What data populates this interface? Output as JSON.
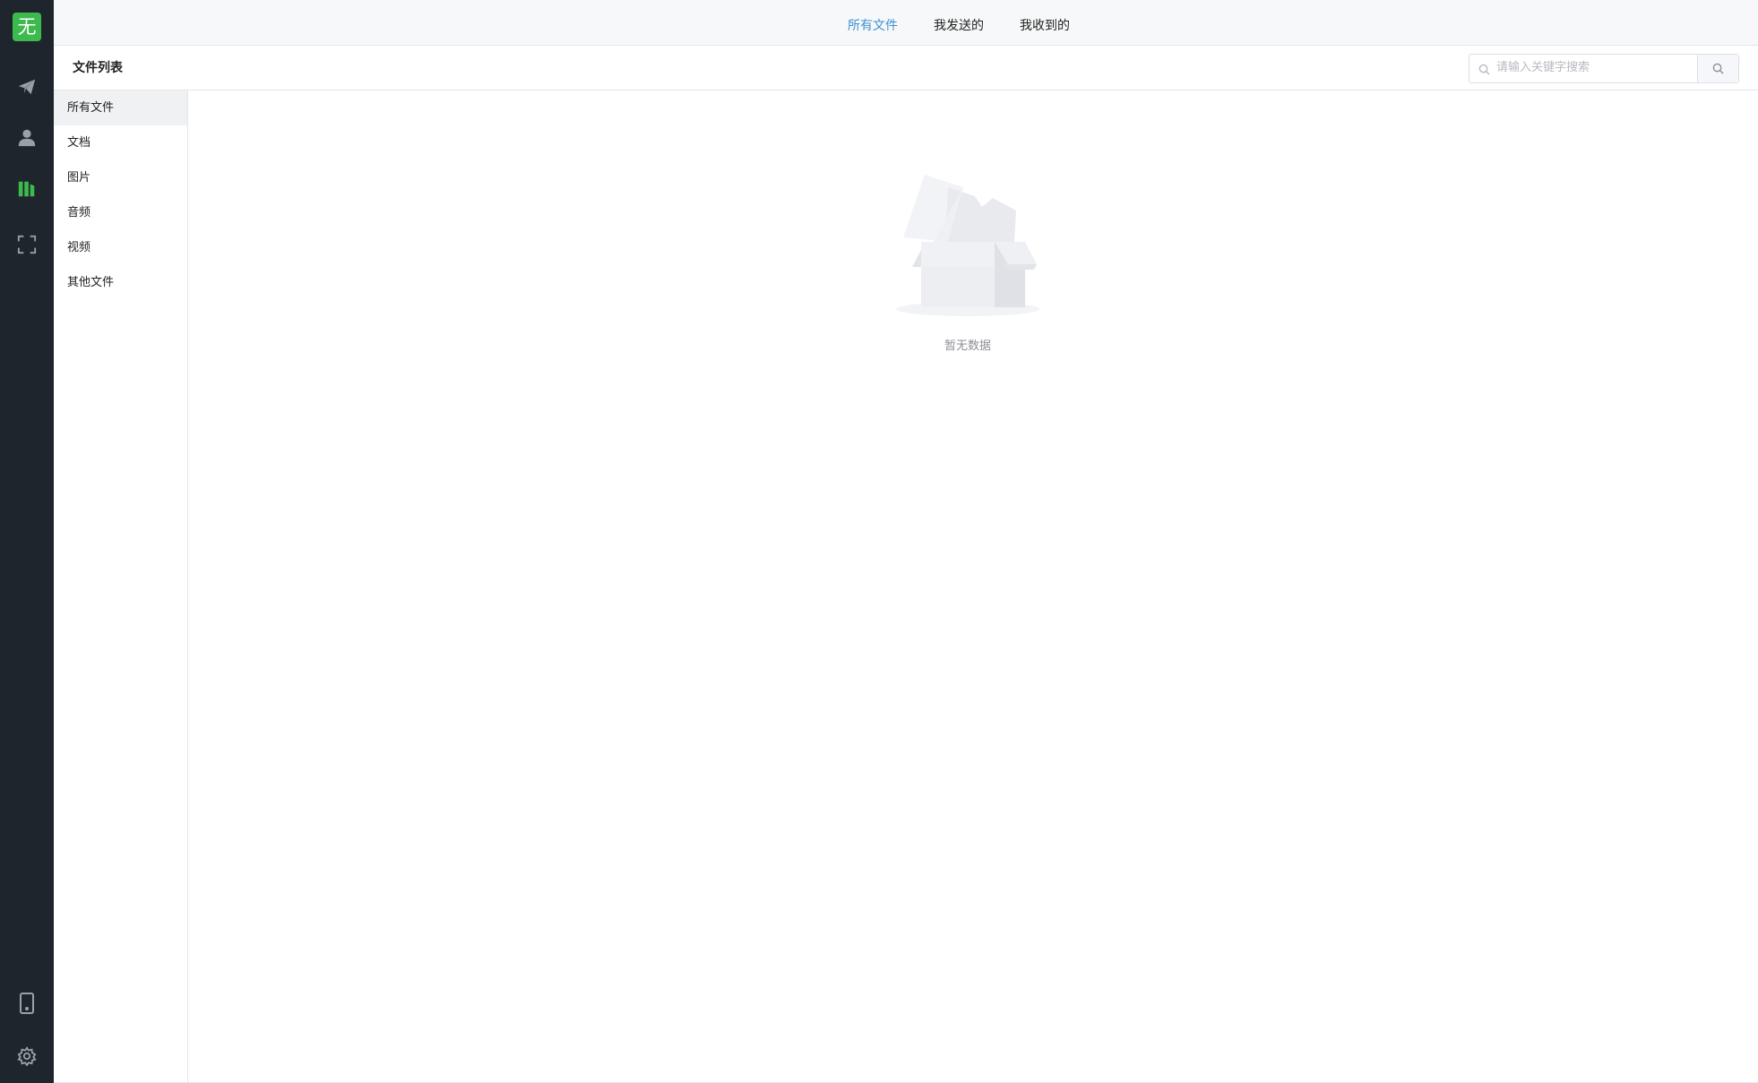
{
  "app": {
    "logo_char": "无",
    "accent_color": "#3cba4e",
    "rail_color": "#1f252c"
  },
  "rail": {
    "items": [
      {
        "icon": "send-icon"
      },
      {
        "icon": "contacts-icon"
      },
      {
        "icon": "files-icon",
        "active": true
      },
      {
        "icon": "scan-icon"
      }
    ],
    "bottom_items": [
      {
        "icon": "phone-icon"
      },
      {
        "icon": "settings-icon"
      }
    ]
  },
  "top_tabs": [
    {
      "label": "所有文件",
      "active": true
    },
    {
      "label": "我发送的"
    },
    {
      "label": "我收到的"
    }
  ],
  "page": {
    "title": "文件列表"
  },
  "search": {
    "placeholder": "请输入关键字搜索"
  },
  "categories": [
    {
      "label": "所有文件",
      "active": true
    },
    {
      "label": "文档"
    },
    {
      "label": "图片"
    },
    {
      "label": "音频"
    },
    {
      "label": "视频"
    },
    {
      "label": "其他文件"
    }
  ],
  "empty_state": {
    "text": "暂无数据"
  }
}
